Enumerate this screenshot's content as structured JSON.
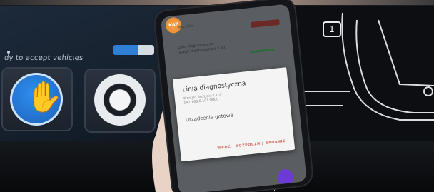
{
  "background": {
    "left_screen_text": "dy to accept vehicles",
    "badge_number": "1"
  },
  "phone": {
    "app_icon_text": "KAP",
    "status_text": "Wszystko",
    "list": {
      "line1": "Linia diagnostyczna",
      "line2": "Stacja diagnostyczna 1.0.0"
    },
    "dialog": {
      "title": "Linia diagnostyczna",
      "subtitle_line1": "Wersja: TestLinia 1.0.0",
      "subtitle_line2": "192.168.0.101:8000",
      "body": "Urządzenie gotowe",
      "action": "WRÓĆ · ROZPOCZNIJ BADANIE"
    }
  },
  "colors": {
    "accent_blue": "#2f8ef0",
    "dialog_action": "#d46a5a",
    "app_orange": "#f6a54a",
    "fab_purple": "#6c3bd6"
  }
}
